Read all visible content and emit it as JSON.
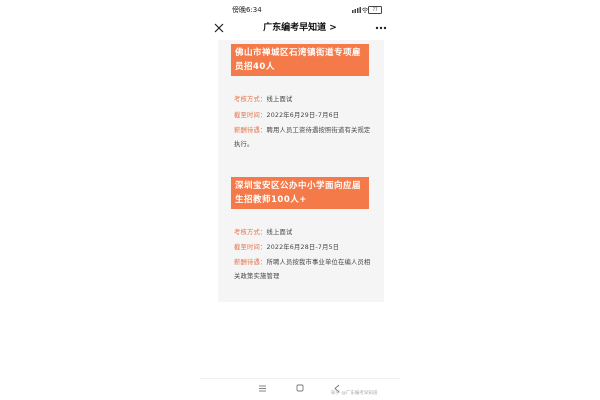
{
  "status_bar": {
    "time": "傍晚6:34",
    "battery": "77"
  },
  "header": {
    "title": "广东编考早知道 >",
    "close_icon": "close-icon",
    "more_icon": "more-icon"
  },
  "cards": [
    {
      "title": "佛山市禅城区石湾镇街道专项雇员招40人",
      "rows": [
        {
          "key": "考核方式：",
          "value": "线上面试"
        },
        {
          "key": "截至时间：",
          "value": "2022年6月29日-7月6日"
        },
        {
          "key": "薪酬待遇：",
          "value": "聘用人员工资待遇按照街道有关规定执行。"
        }
      ]
    },
    {
      "title": "深圳宝安区公办中小学面向应届生招教师100人+",
      "rows": [
        {
          "key": "考核方式：",
          "value": "线上面试"
        },
        {
          "key": "截至时间：",
          "value": "2022年6月28日-7月5日"
        },
        {
          "key": "薪酬待遇：",
          "value": "所聘人员按我市事业单位在编人员相关政策实施管理"
        }
      ]
    }
  ],
  "bottom_bar": {
    "watermark": "知乎 @广东编考早知道",
    "menu_icon": "menu-icon",
    "home_icon": "home-icon",
    "back_icon": "back-icon"
  },
  "colors": {
    "accent": "#f47a4a",
    "key_text": "#e8734a",
    "card_bg": "#f5f5f5"
  }
}
